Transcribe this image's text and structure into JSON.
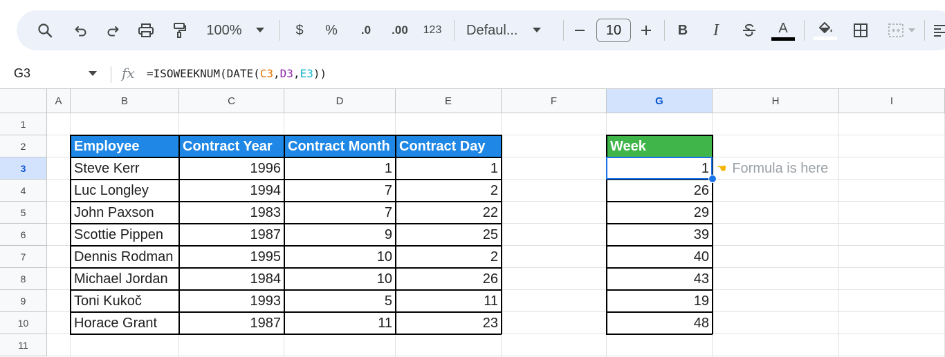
{
  "toolbar": {
    "zoom": "100%",
    "currency": "$",
    "percent": "%",
    "decrease_decimal": ".0",
    "increase_decimal": ".00",
    "number_format": "123",
    "font_family": "Defaul...",
    "font_size": "10",
    "bold": "B",
    "italic": "I",
    "text_color_letter": "A"
  },
  "formula_bar": {
    "name_box": "G3",
    "fx": "fx",
    "formula_prefix": "=ISOWEEKNUM(DATE(",
    "arg1": "C3",
    "comma1": ",",
    "arg2": "D3",
    "comma2": ",",
    "arg3": "E3",
    "formula_suffix": "))"
  },
  "colors": {
    "arg1": "#e37400",
    "arg2": "#8e24aa",
    "arg3": "#12b5cb",
    "header_blue": "#1f87e5",
    "header_green": "#40b54a",
    "selection": "#1a73e8"
  },
  "columns": [
    "A",
    "B",
    "C",
    "D",
    "E",
    "F",
    "G",
    "H",
    "I"
  ],
  "rows": [
    "1",
    "2",
    "3",
    "4",
    "5",
    "6",
    "7",
    "8",
    "9",
    "10",
    "11"
  ],
  "table": {
    "headers": [
      "Employee",
      "Contract Year",
      "Contract Month",
      "Contract Day"
    ],
    "rows": [
      [
        "Steve Kerr",
        "1996",
        "1",
        "1"
      ],
      [
        "Luc Longley",
        "1994",
        "7",
        "2"
      ],
      [
        "John Paxson",
        "1983",
        "7",
        "22"
      ],
      [
        "Scottie Pippen",
        "1987",
        "9",
        "25"
      ],
      [
        "Dennis Rodman",
        "1995",
        "10",
        "2"
      ],
      [
        "Michael Jordan",
        "1984",
        "10",
        "26"
      ],
      [
        "Toni Kukoč",
        "1993",
        "5",
        "11"
      ],
      [
        "Horace Grant",
        "1987",
        "11",
        "23"
      ]
    ]
  },
  "week_table": {
    "header": "Week",
    "values": [
      "1",
      "26",
      "29",
      "39",
      "40",
      "43",
      "19",
      "48"
    ]
  },
  "annotation": {
    "text": "Formula is here",
    "icon": "pointing-hand-icon"
  }
}
